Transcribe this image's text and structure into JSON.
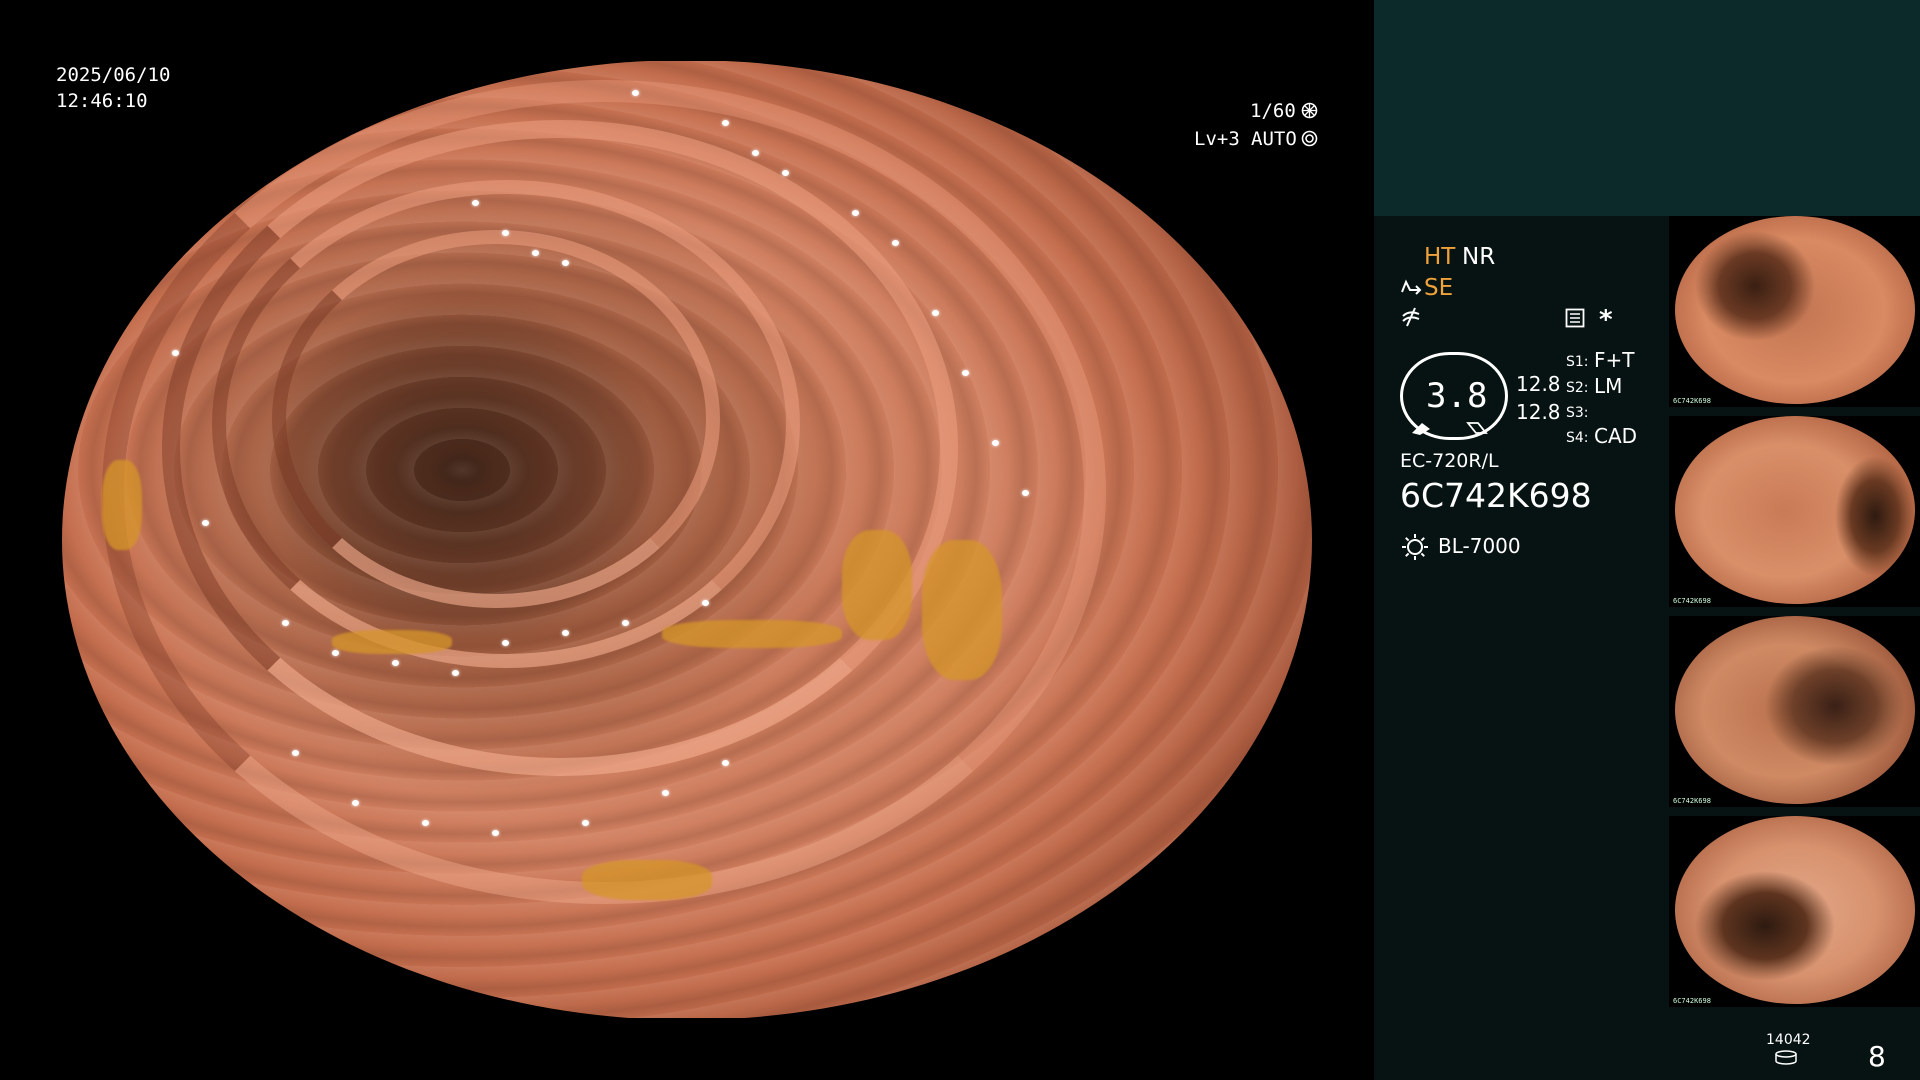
{
  "overlay": {
    "date": "2025/06/10",
    "time": "12:46:10",
    "shutter": "1/60",
    "level": "Lv+3",
    "iris": "AUTO",
    "shutter_icon": "aperture-icon",
    "iris_icon": "iris-icon"
  },
  "panel": {
    "ht_label": "HT",
    "nr_label": "NR",
    "se_label": "SE",
    "se_icon": "tilde-arrow-icon",
    "curve_icon": "not-equal-icon",
    "record_icon": "record-card-icon",
    "star_label": "*",
    "gauge_value": "3.8",
    "readout_top": "12.8",
    "readout_bottom": "12.8",
    "switches": [
      {
        "key": "S1:",
        "value": "F+T"
      },
      {
        "key": "S2:",
        "value": "LM"
      },
      {
        "key": "S3:",
        "value": ""
      },
      {
        "key": "S4:",
        "value": "CAD"
      }
    ],
    "scope_model": "EC-720R/L",
    "scope_serial": "6C742K698",
    "light_source": "BL-7000",
    "light_icon": "sun-icon",
    "counter": "14042",
    "counter_icon": "disk-stack-icon",
    "image_count": "8"
  },
  "thumbnails": [
    {
      "caption": "6C742K698"
    },
    {
      "caption": "6C742K698"
    },
    {
      "caption": "6C742K698"
    },
    {
      "caption": "6C742K698"
    }
  ],
  "colors": {
    "accent_orange": "#f0a23a",
    "panel_bg": "#071312",
    "top_block_bg": "#0c2a2a"
  }
}
